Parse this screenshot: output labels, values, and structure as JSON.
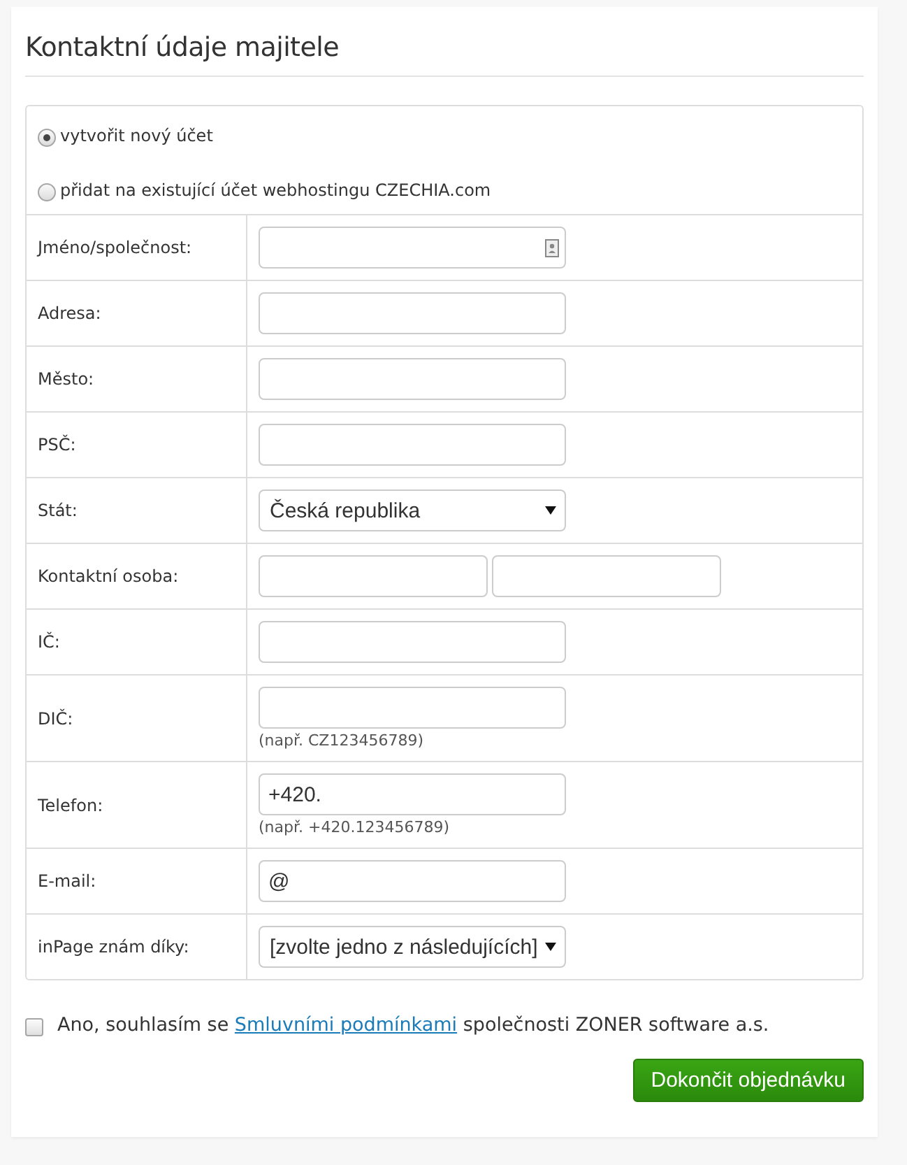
{
  "heading": "Kontaktní údaje majitele",
  "account_options": [
    {
      "label": "vytvořit nový účet",
      "selected": true
    },
    {
      "label": "přidat na existující účet webhostingu CZECHIA.com",
      "selected": false
    }
  ],
  "fields": [
    {
      "kind": "autofill",
      "label": "Jméno/společnost:"
    },
    {
      "kind": "text",
      "label": "Adresa:"
    },
    {
      "kind": "text",
      "label": "Město:"
    },
    {
      "kind": "text",
      "label": "PSČ:"
    },
    {
      "kind": "select",
      "label": "Stát:",
      "value": "Česká republika"
    },
    {
      "kind": "pair",
      "label": "Kontaktní osoba:"
    },
    {
      "kind": "text",
      "label": "IČ:"
    },
    {
      "kind": "text",
      "label": "DIČ:",
      "hint": "(např. CZ123456789)"
    },
    {
      "kind": "text",
      "label": "Telefon:",
      "value": "+420.",
      "hint": "(např. +420.123456789)"
    },
    {
      "kind": "text",
      "label": "E-mail:",
      "value": "@"
    },
    {
      "kind": "select",
      "label": "inPage znám díky:",
      "value": "[zvolte jedno z následujících]"
    }
  ],
  "agreement": {
    "checked": false,
    "text_before": "Ano, souhlasím se ",
    "link": "Smluvními podmínkami",
    "text_after": " společnosti ZONER software a.s."
  },
  "submit_button": "Dokončit objednávku"
}
